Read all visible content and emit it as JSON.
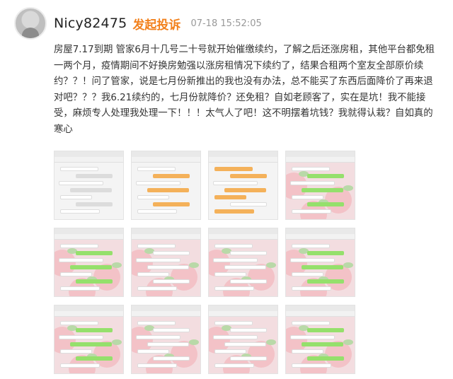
{
  "post": {
    "username": "Nicy82475",
    "action_label": "发起投诉",
    "timestamp": "07-18 15:52:05",
    "body": "房屋7.17到期 管家6月十几号二十号就开始催缴续约，了解之后还涨房租，其他平台都免租一两个月，疫情期间不好换房勉强以涨房租情况下续约了，结果合租两个室友全部原价续约？？！问了管家，说是七月份新推出的我也没有办法，总不能买了东西后面降价了再来退对吧？？？我6.21续约的，七月份就降价？还免租？自如老顾客了，实在是坑！我不能接受，麻烦专人处理我处理一下！！！太气人了吧！这不明摆着坑钱？我就得认栽？自如真的寒心"
  },
  "gallery": {
    "images": [
      {
        "style": "plain",
        "bubbles": "gray"
      },
      {
        "style": "plain",
        "bubbles": "mixed"
      },
      {
        "style": "plain",
        "bubbles": "orange"
      },
      {
        "style": "pink",
        "bubbles": "green"
      },
      {
        "style": "pink",
        "bubbles": "green"
      },
      {
        "style": "pink",
        "bubbles": "white"
      },
      {
        "style": "pink",
        "bubbles": "white"
      },
      {
        "style": "pink",
        "bubbles": "green"
      },
      {
        "style": "pink",
        "bubbles": "green"
      },
      {
        "style": "pink",
        "bubbles": "white"
      },
      {
        "style": "pink",
        "bubbles": "white"
      },
      {
        "style": "pink",
        "bubbles": "green"
      }
    ]
  },
  "icons": {
    "avatar": "user-avatar"
  },
  "colors": {
    "action": "#f2811d",
    "timestamp": "#999999",
    "text": "#333333"
  }
}
